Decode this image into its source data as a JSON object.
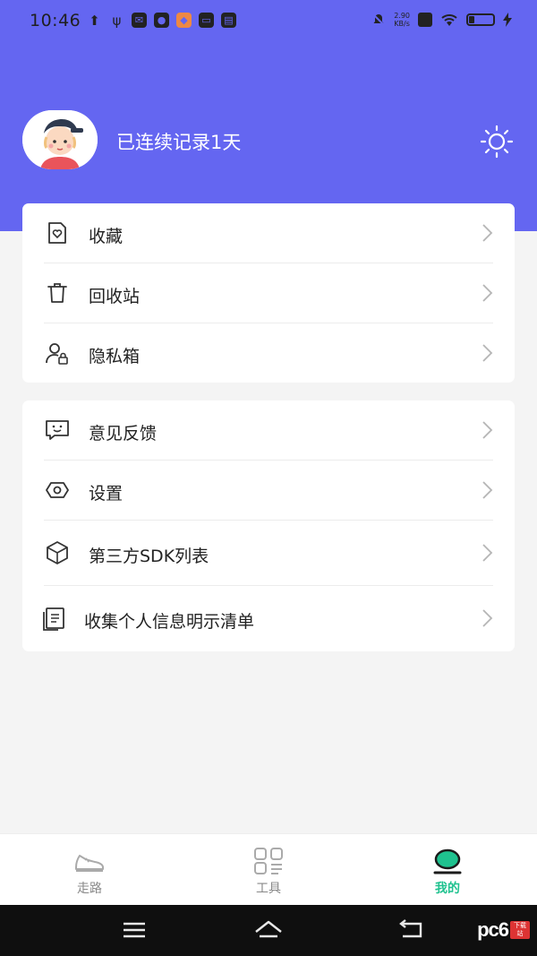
{
  "status_bar": {
    "time": "10:46",
    "net_speed_value": "2.90",
    "net_speed_unit": "KB/s"
  },
  "profile": {
    "streak_text": "已连续记录1天"
  },
  "menu_group_1": [
    {
      "label": "收藏",
      "icon": "favorite-doc-icon"
    },
    {
      "label": "回收站",
      "icon": "trash-icon"
    },
    {
      "label": "隐私箱",
      "icon": "private-user-lock-icon"
    }
  ],
  "menu_group_2": [
    {
      "label": "意见反馈",
      "icon": "feedback-icon"
    },
    {
      "label": "设置",
      "icon": "settings-icon"
    },
    {
      "label": "第三方SDK列表",
      "icon": "sdk-cube-icon"
    },
    {
      "label": "收集个人信息明示清单",
      "icon": "info-list-icon"
    }
  ],
  "tabs": [
    {
      "label": "走路",
      "icon": "shoe-icon",
      "active": false
    },
    {
      "label": "工具",
      "icon": "grid-tools-icon",
      "active": false
    },
    {
      "label": "我的",
      "icon": "profile-tab-icon",
      "active": true
    }
  ],
  "watermark": {
    "brand": "pc6",
    "badge": "下载站"
  },
  "colors": {
    "header_bg": "#6466f1",
    "accent_green": "#1fc28f",
    "page_bg": "#f4f4f4"
  }
}
